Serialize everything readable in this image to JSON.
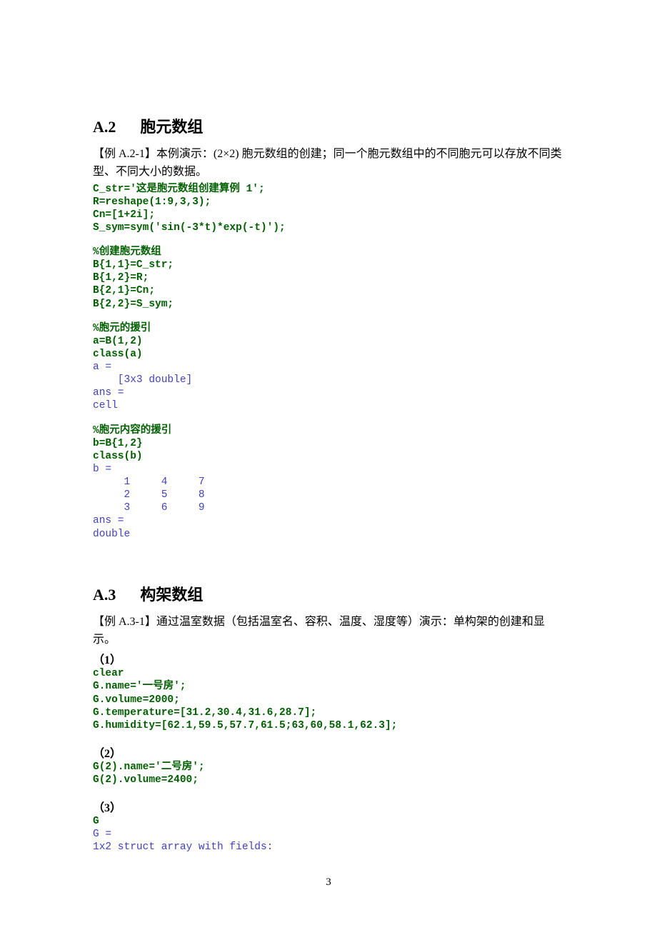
{
  "section_a2": {
    "num": "A.2",
    "title": "胞元数组",
    "example_intro": "【例 A.2-1】本例演示：(2×2) 胞元数组的创建；同一个胞元数组中的不同胞元可以存放不同类型、不同大小的数据。",
    "code1": "C_str='这是胞元数组创建算例 1';\nR=reshape(1:9,3,3);\nCn=[1+2i];\nS_sym=sym('sin(-3*t)*exp(-t)');",
    "comment2": "%创建胞元数组",
    "code2": "B{1,1}=C_str;\nB{1,2}=R;\nB{2,1}=Cn;\nB{2,2}=S_sym;",
    "comment3": "%胞元的援引",
    "code3": "a=B(1,2)\nclass(a)",
    "output1": "a =\n    [3x3 double]\nans =\ncell",
    "comment4": "%胞元内容的援引",
    "code4": "b=B{1,2}\nclass(b)",
    "output2": "b =\n     1     4     7\n     2     5     8\n     3     6     9\nans =\ndouble"
  },
  "section_a3": {
    "num": "A.3",
    "title": "构架数组",
    "example_intro": "【例 A.3-1】通过温室数据（包括温室名、容积、温度、湿度等）演示：单构架的创建和显示。",
    "step1_label": "（1）",
    "code1": "clear\nG.name='一号房';\nG.volume=2000;\nG.temperature=[31.2,30.4,31.6,28.7];\nG.humidity=[62.1,59.5,57.7,61.5;63,60,58.1,62.3];",
    "step2_label": "（2）",
    "code2": "G(2).name='二号房';\nG(2).volume=2400;",
    "step3_label": "（3）",
    "code3": "G",
    "output1": "G =\n1x2 struct array with fields:"
  },
  "page_number": "3"
}
